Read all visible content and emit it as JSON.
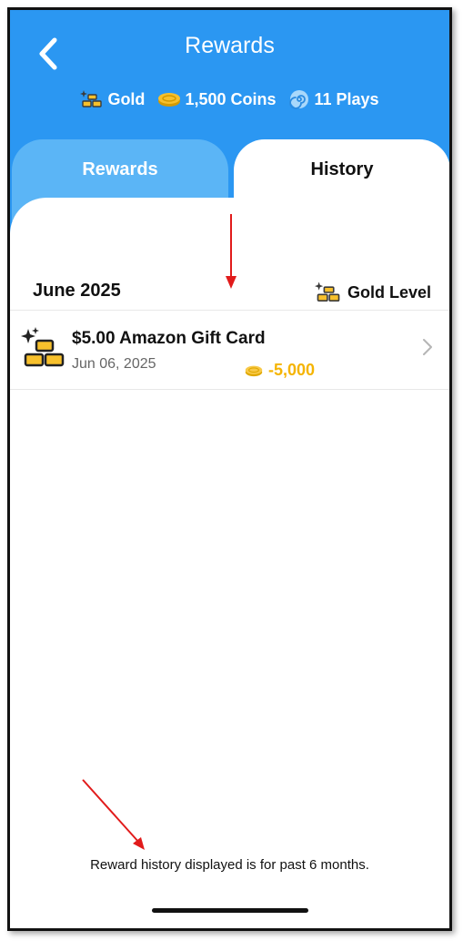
{
  "header": {
    "title": "Rewards",
    "stats": {
      "level": "Gold",
      "coins": "1,500 Coins",
      "plays": "11 Plays"
    }
  },
  "tabs": [
    {
      "label": "Rewards",
      "active": false
    },
    {
      "label": "History",
      "active": true
    }
  ],
  "history": {
    "month": "June 2025",
    "level_label": "Gold Level",
    "items": [
      {
        "title": "$5.00 Amazon Gift Card",
        "date": "Jun 06, 2025",
        "coins": "-5,000"
      }
    ]
  },
  "footer": {
    "note": "Reward history displayed is for past 6 months."
  },
  "colors": {
    "header_blue": "#2b97f2",
    "inactive_tab_blue": "#5bb5f6",
    "gold": "#f5b400",
    "annotation_red": "#e11b1b"
  },
  "icons": {
    "back": "back-chevron-icon",
    "gold": "gold-bars-icon",
    "coin": "coin-icon",
    "plays": "swirl-icon",
    "chevron": "chevron-right-icon"
  }
}
